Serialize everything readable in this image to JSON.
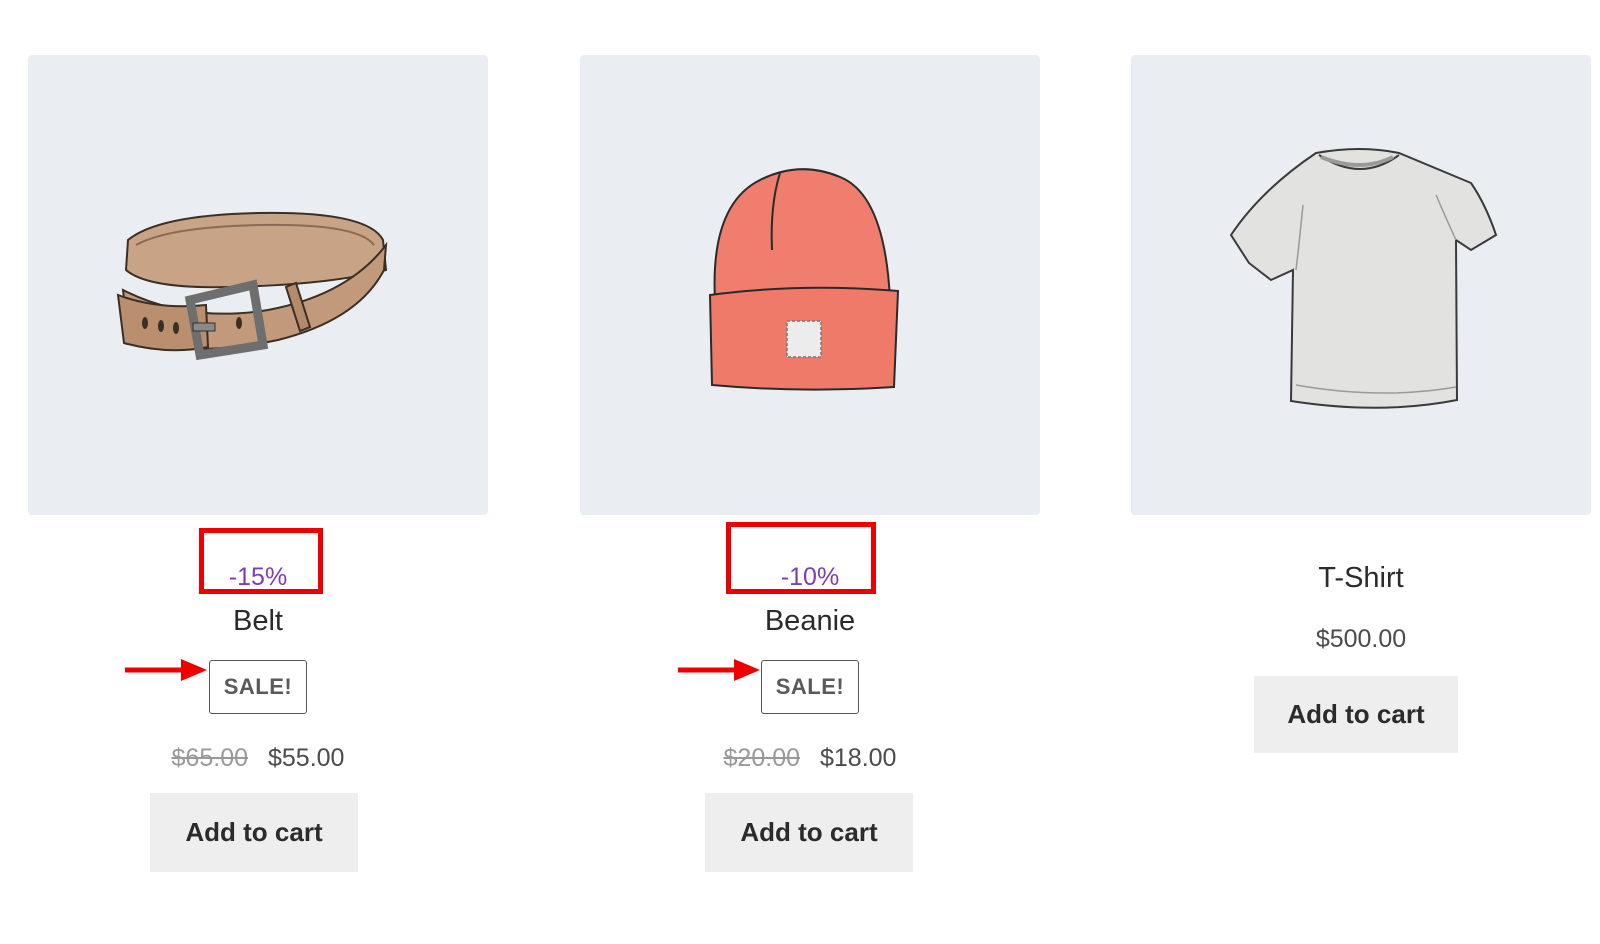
{
  "products": [
    {
      "name": "Belt",
      "discount": "-15%",
      "badge": "SALE!",
      "old_price": "$65.00",
      "price": "$55.00",
      "button": "Add to cart",
      "image_icon": "belt-image"
    },
    {
      "name": "Beanie",
      "discount": "-10%",
      "badge": "SALE!",
      "old_price": "$20.00",
      "price": "$18.00",
      "button": "Add to cart",
      "image_icon": "beanie-image"
    },
    {
      "name": "T-Shirt",
      "price": "$500.00",
      "button": "Add to cart",
      "image_icon": "tshirt-image"
    }
  ],
  "colors": {
    "thumbnail_bg": "#eaeef2",
    "discount_text": "#7a3fb8",
    "annotation_red": "#ee0000",
    "button_bg": "#eeeeee"
  }
}
